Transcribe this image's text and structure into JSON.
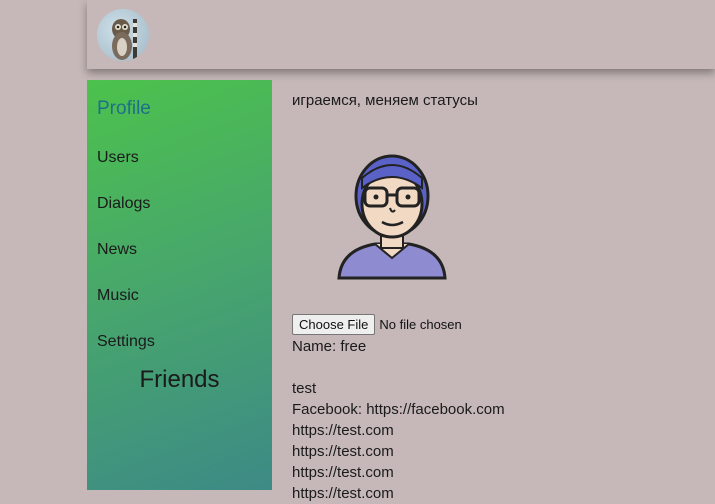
{
  "header": {
    "avatar_alt": "lemur-avatar"
  },
  "sidebar": {
    "items": [
      {
        "label": "Profile",
        "active": true
      },
      {
        "label": "Users"
      },
      {
        "label": "Dialogs"
      },
      {
        "label": "News"
      },
      {
        "label": "Music"
      },
      {
        "label": "Settings"
      }
    ],
    "friends_title": "Friends"
  },
  "profile": {
    "status": "играемся, меняем статусы",
    "file_button": "Choose File",
    "file_status": "No file chosen",
    "name_line": "Name: free",
    "about": "test",
    "contacts": [
      "Facebook: https://facebook.com",
      "https://test.com",
      "https://test.com",
      "https://test.com",
      "https://test.com"
    ]
  },
  "colors": {
    "background": "#c6b8b8",
    "sidebar_gradient_start": "#4cc24c",
    "sidebar_gradient_end": "#3d8a86",
    "active_link": "#1f6f8b"
  }
}
